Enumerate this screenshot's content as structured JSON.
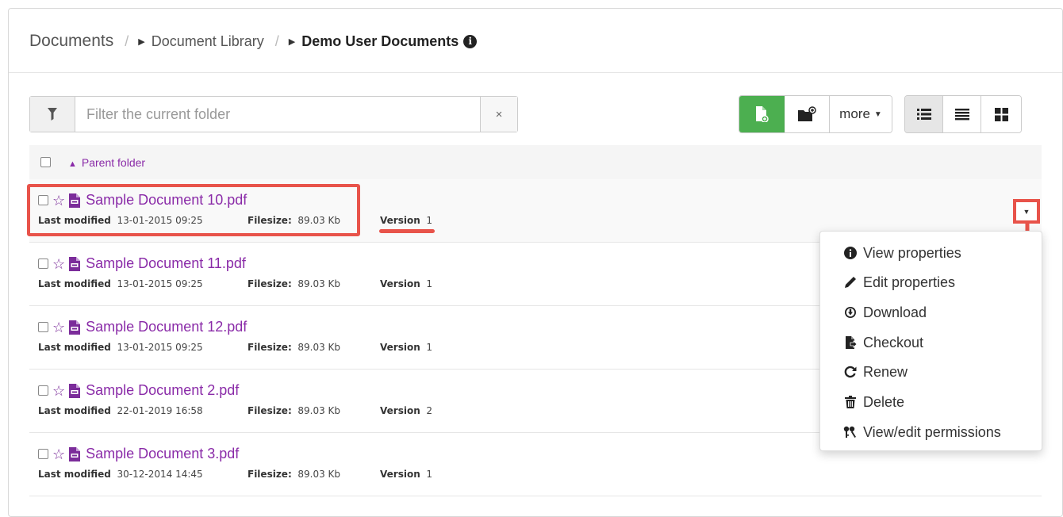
{
  "breadcrumb": {
    "root": "Documents",
    "separator": "/",
    "middle": "Document Library",
    "current": "Demo User Documents",
    "info_glyph": "i"
  },
  "filter": {
    "placeholder": "Filter the current folder",
    "value": "",
    "clear_glyph": "×",
    "icon": "filter-icon"
  },
  "toolbar": {
    "more_label": "more",
    "buttons": [
      "new-document",
      "new-folder",
      "more",
      "view-detailed",
      "view-simple",
      "view-gallery"
    ],
    "accent": "#4caf50"
  },
  "list": {
    "parent_label": "Parent folder",
    "labels": {
      "modified": "Last modified",
      "size": "Filesize:",
      "version": "Version"
    },
    "rows": [
      {
        "name": "Sample Document 10.pdf",
        "modified": "13-01-2015 09:25",
        "size": "89.03 Kb",
        "version": "1"
      },
      {
        "name": "Sample Document 11.pdf",
        "modified": "13-01-2015 09:25",
        "size": "89.03 Kb",
        "version": "1"
      },
      {
        "name": "Sample Document 12.pdf",
        "modified": "13-01-2015 09:25",
        "size": "89.03 Kb",
        "version": "1"
      },
      {
        "name": "Sample Document 2.pdf",
        "modified": "22-01-2019 16:58",
        "size": "89.03 Kb",
        "version": "2"
      },
      {
        "name": "Sample Document 3.pdf",
        "modified": "30-12-2014 14:45",
        "size": "89.03 Kb",
        "version": "1"
      }
    ]
  },
  "menu": {
    "items": [
      {
        "label": "View properties",
        "icon": "info-icon"
      },
      {
        "label": "Edit properties",
        "icon": "pencil-icon"
      },
      {
        "label": "Download",
        "icon": "download-icon"
      },
      {
        "label": "Checkout",
        "icon": "checkout-icon"
      },
      {
        "label": "Renew",
        "icon": "refresh-icon"
      },
      {
        "label": "Delete",
        "icon": "trash-icon"
      },
      {
        "label": "View/edit permissions",
        "icon": "keys-icon"
      }
    ]
  },
  "colors": {
    "link": "#8a2ba8",
    "annotation": "#e8534a",
    "green": "#4caf50"
  }
}
